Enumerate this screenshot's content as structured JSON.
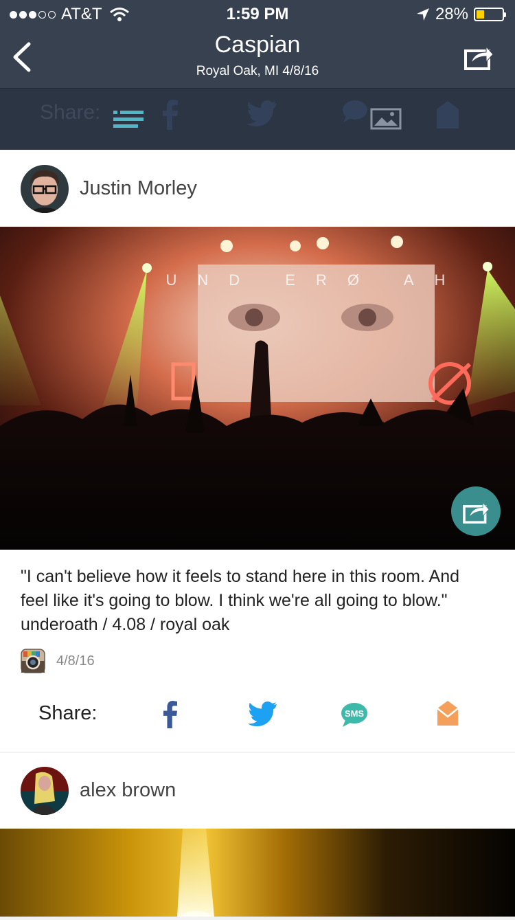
{
  "status": {
    "carrier": "AT&T",
    "time": "1:59 PM",
    "battery": "28%",
    "battery_level": 0.28,
    "icons": [
      "signal-dots",
      "wifi-icon",
      "location-arrow-icon",
      "battery-icon"
    ]
  },
  "nav": {
    "title": "Caspian",
    "subtitle": "Royal Oak, MI 4/8/16",
    "back_icon": "chevron-left-icon",
    "share_icon": "share-icon"
  },
  "sharebar": {
    "label": "Share:",
    "icons": [
      "list-icon",
      "facebook-icon",
      "twitter-icon",
      "sms-icon",
      "image-icon",
      "email-icon"
    ]
  },
  "posts": [
    {
      "user": "Justin Morley",
      "caption": "\"I can't believe how it feels to stand here in this room. And feel like it's going to blow. I think we're all going to blow.\" underoath / 4.08 / royal oak",
      "source_icon": "instagram-icon",
      "date": "4/8/16",
      "share_label": "Share:",
      "photo_text": "UND ERØ AH",
      "colors": {
        "facebook": "#3b5998",
        "twitter": "#1da1f2",
        "sms": "#3cb9a8",
        "email": "#f5a05a",
        "accent": "#4fb7c5"
      }
    },
    {
      "user": "alex brown"
    }
  ]
}
